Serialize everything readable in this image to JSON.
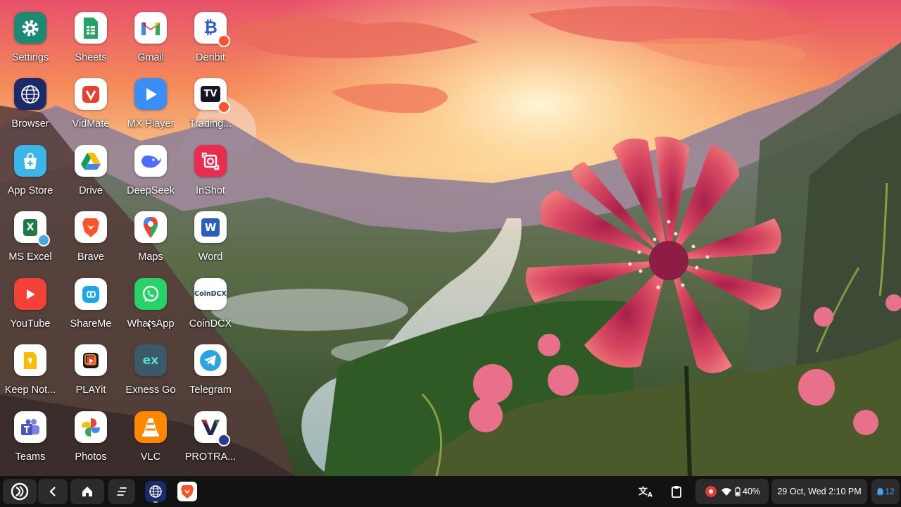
{
  "apps": [
    {
      "label": "Settings",
      "icon": "settings-icon",
      "name": "app-settings"
    },
    {
      "label": "Sheets",
      "icon": "sheets-icon",
      "name": "app-sheets"
    },
    {
      "label": "Gmail",
      "icon": "gmail-icon",
      "name": "app-gmail"
    },
    {
      "label": "Deribit",
      "icon": "deribit-icon",
      "name": "app-deribit"
    },
    {
      "label": "Browser",
      "icon": "browser-icon",
      "name": "app-browser"
    },
    {
      "label": "VidMate",
      "icon": "vidmate-icon",
      "name": "app-vidmate"
    },
    {
      "label": "MX Player",
      "icon": "mx-player-icon",
      "name": "app-mx-player"
    },
    {
      "label": "Trading...",
      "icon": "tradingview-icon",
      "name": "app-tradingview"
    },
    {
      "label": "App Store",
      "icon": "app-store-icon",
      "name": "app-app-store"
    },
    {
      "label": "Drive",
      "icon": "drive-icon",
      "name": "app-drive"
    },
    {
      "label": "DeepSeek",
      "icon": "deepseek-icon",
      "name": "app-deepseek"
    },
    {
      "label": "InShot",
      "icon": "inshot-icon",
      "name": "app-inshot"
    },
    {
      "label": "MS Excel",
      "icon": "excel-icon",
      "name": "app-ms-excel"
    },
    {
      "label": "Brave",
      "icon": "brave-icon",
      "name": "app-brave"
    },
    {
      "label": "Maps",
      "icon": "maps-icon",
      "name": "app-maps"
    },
    {
      "label": "Word",
      "icon": "word-icon",
      "name": "app-word"
    },
    {
      "label": "YouTube",
      "icon": "youtube-icon",
      "name": "app-youtube"
    },
    {
      "label": "ShareMe",
      "icon": "shareme-icon",
      "name": "app-shareme"
    },
    {
      "label": "WhatsApp",
      "icon": "whatsapp-icon",
      "name": "app-whatsapp"
    },
    {
      "label": "CoinDCX",
      "icon": "coindcx-icon",
      "name": "app-coindcx"
    },
    {
      "label": "Keep Not...",
      "icon": "keep-notes-icon",
      "name": "app-keep-notes"
    },
    {
      "label": "PLAYit",
      "icon": "playit-icon",
      "name": "app-playit"
    },
    {
      "label": "Exness Go",
      "icon": "exness-icon",
      "name": "app-exness-go"
    },
    {
      "label": "Telegram",
      "icon": "telegram-icon",
      "name": "app-telegram"
    },
    {
      "label": "Teams",
      "icon": "teams-icon",
      "name": "app-teams"
    },
    {
      "label": "Photos",
      "icon": "photos-icon",
      "name": "app-photos"
    },
    {
      "label": "VLC",
      "icon": "vlc-icon",
      "name": "app-vlc"
    },
    {
      "label": "PROTRA...",
      "icon": "protrader-icon",
      "name": "app-protrader"
    }
  ],
  "icon_text": {
    "deribit": "₿",
    "tradingview": "TV",
    "word": "W",
    "coindcx": "CoinDCX",
    "exness": "ex",
    "teams": "T",
    "excel": "X"
  },
  "taskbar": {
    "start_icon": "launcher-icon",
    "back_icon": "back-icon",
    "home_icon": "home-icon",
    "recents_icon": "recents-icon",
    "pinned": [
      {
        "icon": "browser-icon"
      },
      {
        "icon": "brave-icon"
      }
    ],
    "translate_icon": "translate-icon",
    "clipboard_icon": "clipboard-icon",
    "battery": "40%",
    "datetime": "29 Oct, Wed 2:10 PM",
    "notifications": "12"
  },
  "colors": {
    "taskbar_bg": "#121212",
    "pill_bg": "#2b2b2b",
    "settings_teal": "#1a8a73",
    "sheets_green": "#21a464",
    "youtube_red": "#f44336",
    "whatsapp_green": "#25d366",
    "telegram_blue": "#29a5e3",
    "inshot_red": "#ea2d4e"
  }
}
